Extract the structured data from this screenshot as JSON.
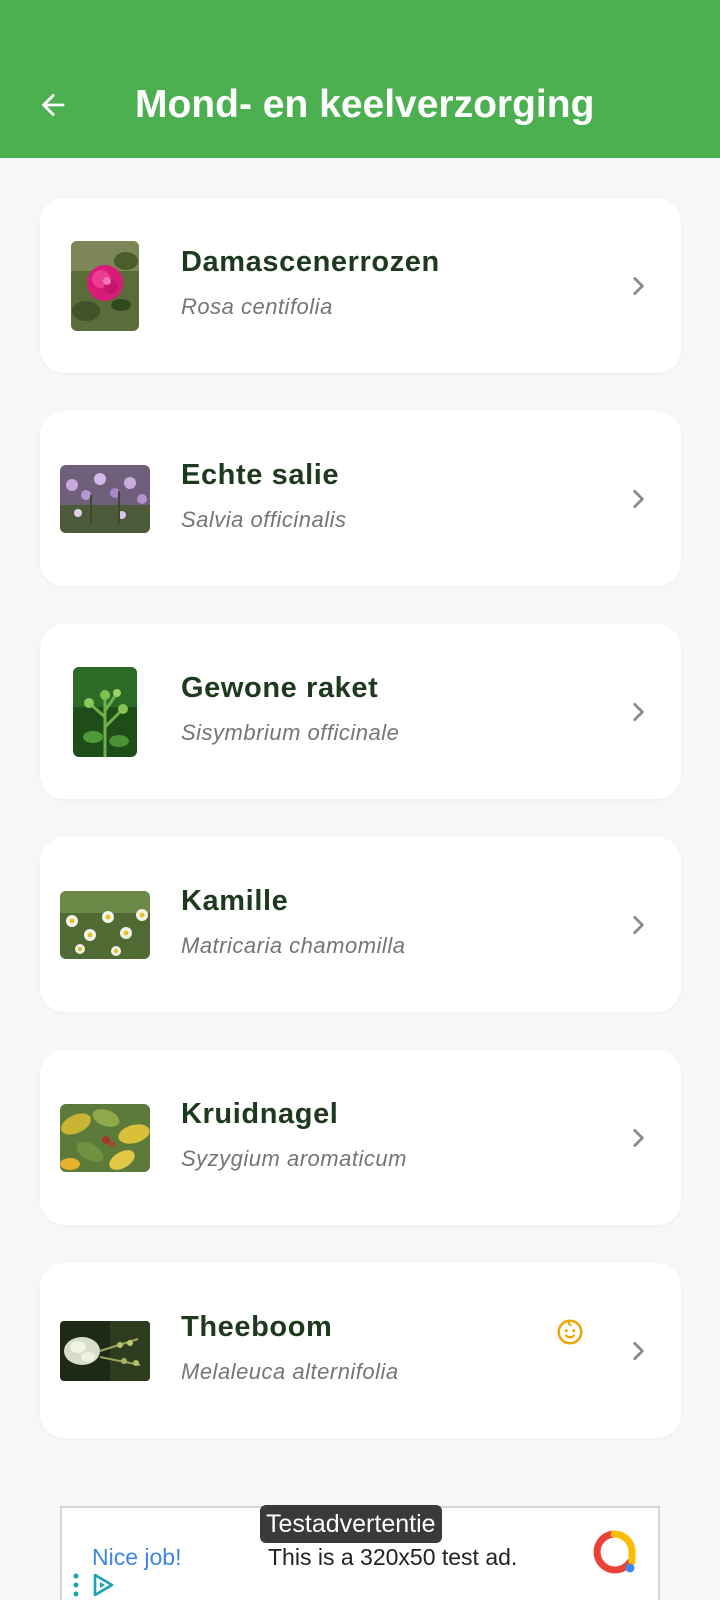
{
  "header": {
    "title": "Mond- en keelverzorging",
    "back_icon": "arrow-left-icon"
  },
  "colors": {
    "appbar": "#4caf50",
    "name_text": "#1e3a1e",
    "latin_text": "#757575",
    "baby_icon": "#f0a400"
  },
  "plants": [
    {
      "name": "Damascenerrozen",
      "latin": "Rosa centifolia",
      "image": "rose-photo"
    },
    {
      "name": "Echte salie",
      "latin": "Salvia officinalis",
      "image": "sage-photo"
    },
    {
      "name": "Gewone raket",
      "latin": "Sisymbrium officinale",
      "image": "hedge-mustard-photo"
    },
    {
      "name": "Kamille",
      "latin": "Matricaria chamomilla",
      "image": "chamomile-photo"
    },
    {
      "name": "Kruidnagel",
      "latin": "Syzygium aromaticum",
      "image": "clove-photo"
    },
    {
      "name": "Theeboom",
      "latin": "Melaleuca alternifolia",
      "image": "tea-tree-photo",
      "badge_icon": "baby-face-icon"
    }
  ],
  "ad": {
    "badge": "Testadvertentie",
    "headline": "Nice job!",
    "text": "This is a 320x50 test ad."
  }
}
